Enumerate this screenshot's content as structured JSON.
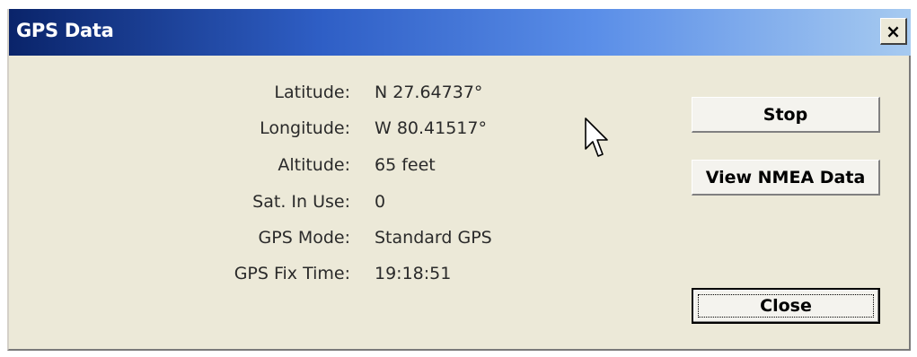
{
  "window": {
    "title": "GPS Data",
    "close_glyph": "×"
  },
  "fields": [
    {
      "label": "Latitude:",
      "value": "N 27.64737°"
    },
    {
      "label": "Longitude:",
      "value": "W 80.41517°"
    },
    {
      "label": "Altitude:",
      "value": "65 feet"
    },
    {
      "label": "Sat. In Use:",
      "value": "0"
    },
    {
      "label": "GPS Mode:",
      "value": "Standard GPS"
    },
    {
      "label": "GPS Fix Time:",
      "value": "19:18:51"
    }
  ],
  "buttons": {
    "stop_label": "Stop",
    "view_nmea_label": "View NMEA Data",
    "close_label": "Close"
  },
  "icons": {
    "cursor": "mouse-pointer-icon"
  },
  "colors": {
    "titlebar_start": "#0a246a",
    "titlebar_end": "#a6caf0",
    "dialog_background": "#ece9d8"
  }
}
